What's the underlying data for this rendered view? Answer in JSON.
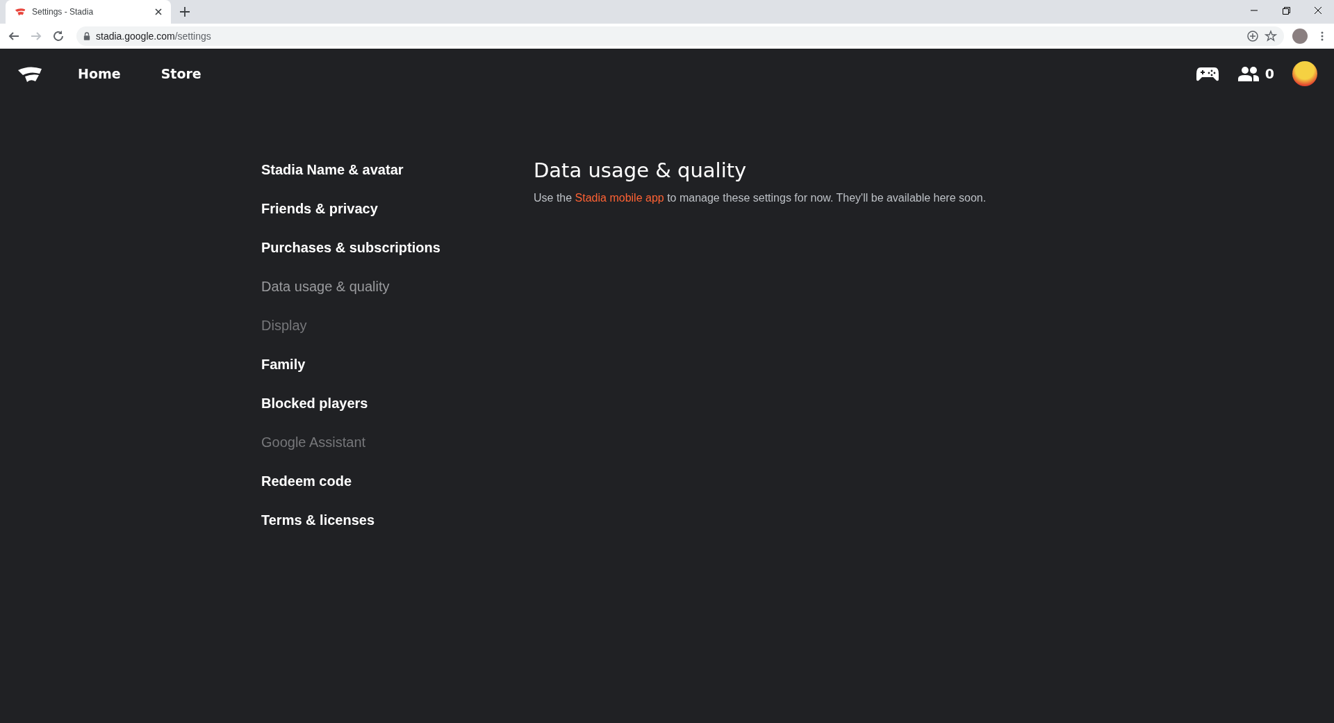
{
  "browser": {
    "tab": {
      "title": "Settings - Stadia"
    },
    "address": {
      "host": "stadia.google.com",
      "path": "/settings"
    }
  },
  "nav": {
    "links": [
      {
        "label": "Home"
      },
      {
        "label": "Store"
      }
    ],
    "friends_count": "0"
  },
  "sidebar": {
    "items": [
      {
        "label": "Stadia Name & avatar",
        "selected": false,
        "disabled": false
      },
      {
        "label": "Friends & privacy",
        "selected": false,
        "disabled": false
      },
      {
        "label": "Purchases & subscriptions",
        "selected": false,
        "disabled": false
      },
      {
        "label": "Data usage & quality",
        "selected": true,
        "disabled": false
      },
      {
        "label": "Display",
        "selected": false,
        "disabled": true
      },
      {
        "label": "Family",
        "selected": false,
        "disabled": false
      },
      {
        "label": "Blocked players",
        "selected": false,
        "disabled": false
      },
      {
        "label": "Google Assistant",
        "selected": false,
        "disabled": true
      },
      {
        "label": "Redeem code",
        "selected": false,
        "disabled": false
      },
      {
        "label": "Terms & licenses",
        "selected": false,
        "disabled": false
      }
    ]
  },
  "content": {
    "title": "Data usage & quality",
    "message": {
      "before": "Use the ",
      "link": "Stadia mobile app",
      "after": " to manage these settings for now. They'll be available here soon."
    }
  }
}
